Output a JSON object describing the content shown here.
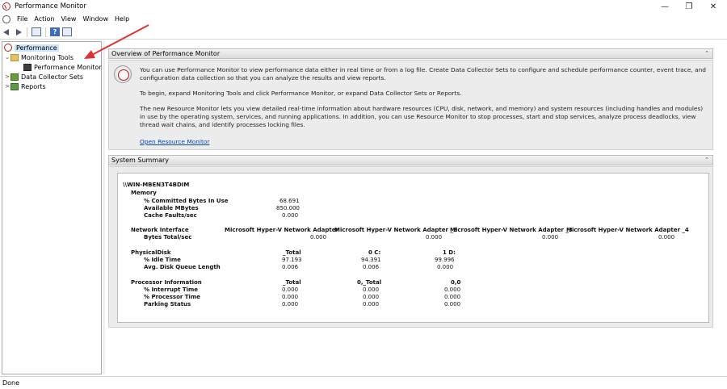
{
  "window": {
    "title": "Performance Monitor",
    "minimize": "—",
    "restore": "❐",
    "close": "✕"
  },
  "menu": {
    "items": [
      "File",
      "Action",
      "View",
      "Window",
      "Help"
    ]
  },
  "toolbar": {
    "icons": [
      "back-arrow-icon",
      "forward-arrow-icon",
      "show-hide-tree-icon",
      "help-icon",
      "properties-icon"
    ]
  },
  "tree": {
    "items": [
      {
        "label": "Performance",
        "icon": "performance-icon",
        "expander": "",
        "selected": true
      },
      {
        "label": "Monitoring Tools",
        "icon": "folder-icon",
        "expander": "⌄",
        "selected": false
      },
      {
        "label": "Performance Monitor",
        "icon": "monitor-icon",
        "expander": "",
        "selected": false
      },
      {
        "label": "Data Collector Sets",
        "icon": "data-collector-icon",
        "expander": ">",
        "selected": false
      },
      {
        "label": "Reports",
        "icon": "reports-icon",
        "expander": ">",
        "selected": false
      }
    ]
  },
  "overview": {
    "header": "Overview of Performance Monitor",
    "para1": "You can use Performance Monitor to view performance data either in real time or from a log file. Create Data Collector Sets to configure and schedule performance counter, event trace, and configuration data collection so that you can analyze the results and view reports.",
    "para2": "To begin, expand Monitoring Tools and click Performance Monitor, or expand Data Collector Sets or Reports.",
    "para3": "The new Resource Monitor lets you view detailed real-time information about hardware resources (CPU, disk, network, and memory) and system resources (including handles and modules) in use by the operating system, services, and running applications. In addition, you can use Resource Monitor to stop processes, start and stop services, analyze process deadlocks, view thread wait chains, and identify processes locking files.",
    "link": "Open Resource Monitor"
  },
  "summary": {
    "header": "System Summary",
    "machine": "\\\\WIN-MBEN3T4BDIM",
    "memory": {
      "title": "Memory",
      "rows": [
        {
          "label": "% Committed Bytes In Use",
          "value": "68.691"
        },
        {
          "label": "Available MBytes",
          "value": "850.000"
        },
        {
          "label": "Cache Faults/sec",
          "value": "0.000"
        }
      ]
    },
    "network": {
      "title": "Network Interface",
      "columns": [
        "Microsoft Hyper-V Network Adapter",
        "Microsoft Hyper-V Network Adapter _2",
        "Microsoft Hyper-V Network Adapter _3",
        "Microsoft Hyper-V Network Adapter _4"
      ],
      "row_label": "Bytes Total/sec",
      "values": [
        "0.000",
        "0.000",
        "0.000",
        "0.000"
      ]
    },
    "disk": {
      "title": "PhysicalDisk",
      "columns": [
        "_Total",
        "0 C:",
        "1 D:"
      ],
      "rows": [
        {
          "label": "% Idle Time",
          "values": [
            "97.193",
            "94.391",
            "99.996"
          ]
        },
        {
          "label": "Avg. Disk Queue Length",
          "values": [
            "0.006",
            "0.006",
            "0.000"
          ]
        }
      ]
    },
    "processor": {
      "title": "Processor Information",
      "columns": [
        "_Total",
        "0,_Total",
        "0,0"
      ],
      "rows": [
        {
          "label": "% Interrupt Time",
          "values": [
            "0.000",
            "0.000",
            "0.000"
          ]
        },
        {
          "label": "% Processor Time",
          "values": [
            "0.000",
            "0.000",
            "0.000"
          ]
        },
        {
          "label": "Parking Status",
          "values": [
            "0.000",
            "0.000",
            "0.000"
          ]
        }
      ]
    }
  },
  "status": {
    "text": "Done"
  },
  "colors": {
    "annotation_arrow": "#e03030",
    "selected_row": "#cde3f7",
    "link": "#0645ad"
  }
}
